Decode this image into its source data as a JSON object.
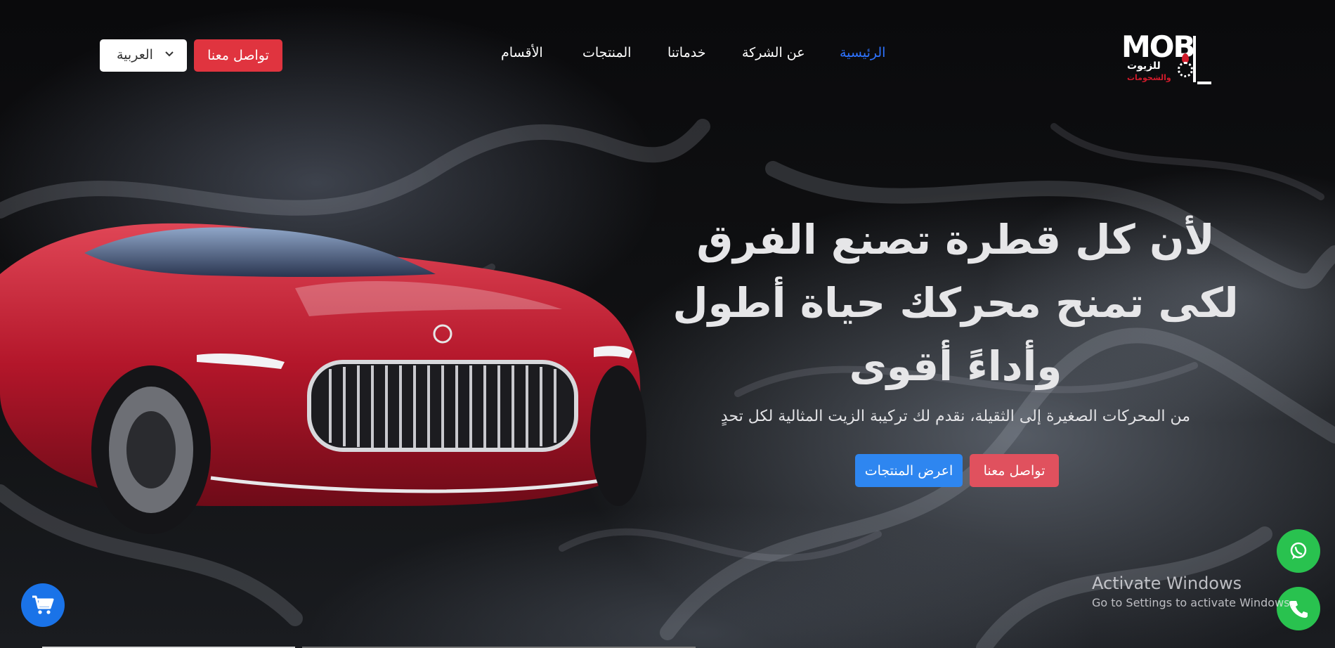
{
  "brand": {
    "logo_main": "MOB",
    "logo_line1": "للزيوت",
    "logo_line2": "والشحومات"
  },
  "nav": {
    "items": [
      {
        "label": "الرئيسية",
        "active": true
      },
      {
        "label": "عن الشركة",
        "active": false
      },
      {
        "label": "خدماتنا",
        "active": false
      },
      {
        "label": "المنتجات",
        "active": false
      },
      {
        "label": "الأقسام",
        "active": false
      }
    ],
    "contact_label": "تواصل معنا",
    "language_selected": "العربية"
  },
  "hero": {
    "title": "لأن كل قطرة تصنع الفرق لكى تمنح محركك حياة أطول وأداءً أقوى",
    "subtitle": "من المحركات الصغيرة إلى الثقيلة، نقدم لك تركيبة الزيت المثالية لكل تحدٍ",
    "primary_button": "اعرض المنتجات",
    "secondary_button": "تواصل معنا"
  },
  "floating": {
    "cart_icon": "cart-icon",
    "whatsapp_icon": "whatsapp-icon",
    "phone_icon": "phone-icon"
  },
  "watermark": {
    "title": "Activate Windows",
    "subtitle": "Go to Settings to activate Windows."
  },
  "colors": {
    "accent_blue": "#2e73ff",
    "brand_red": "#e0343f",
    "button_blue": "#2e86f0",
    "whatsapp_green": "#29c24f"
  }
}
